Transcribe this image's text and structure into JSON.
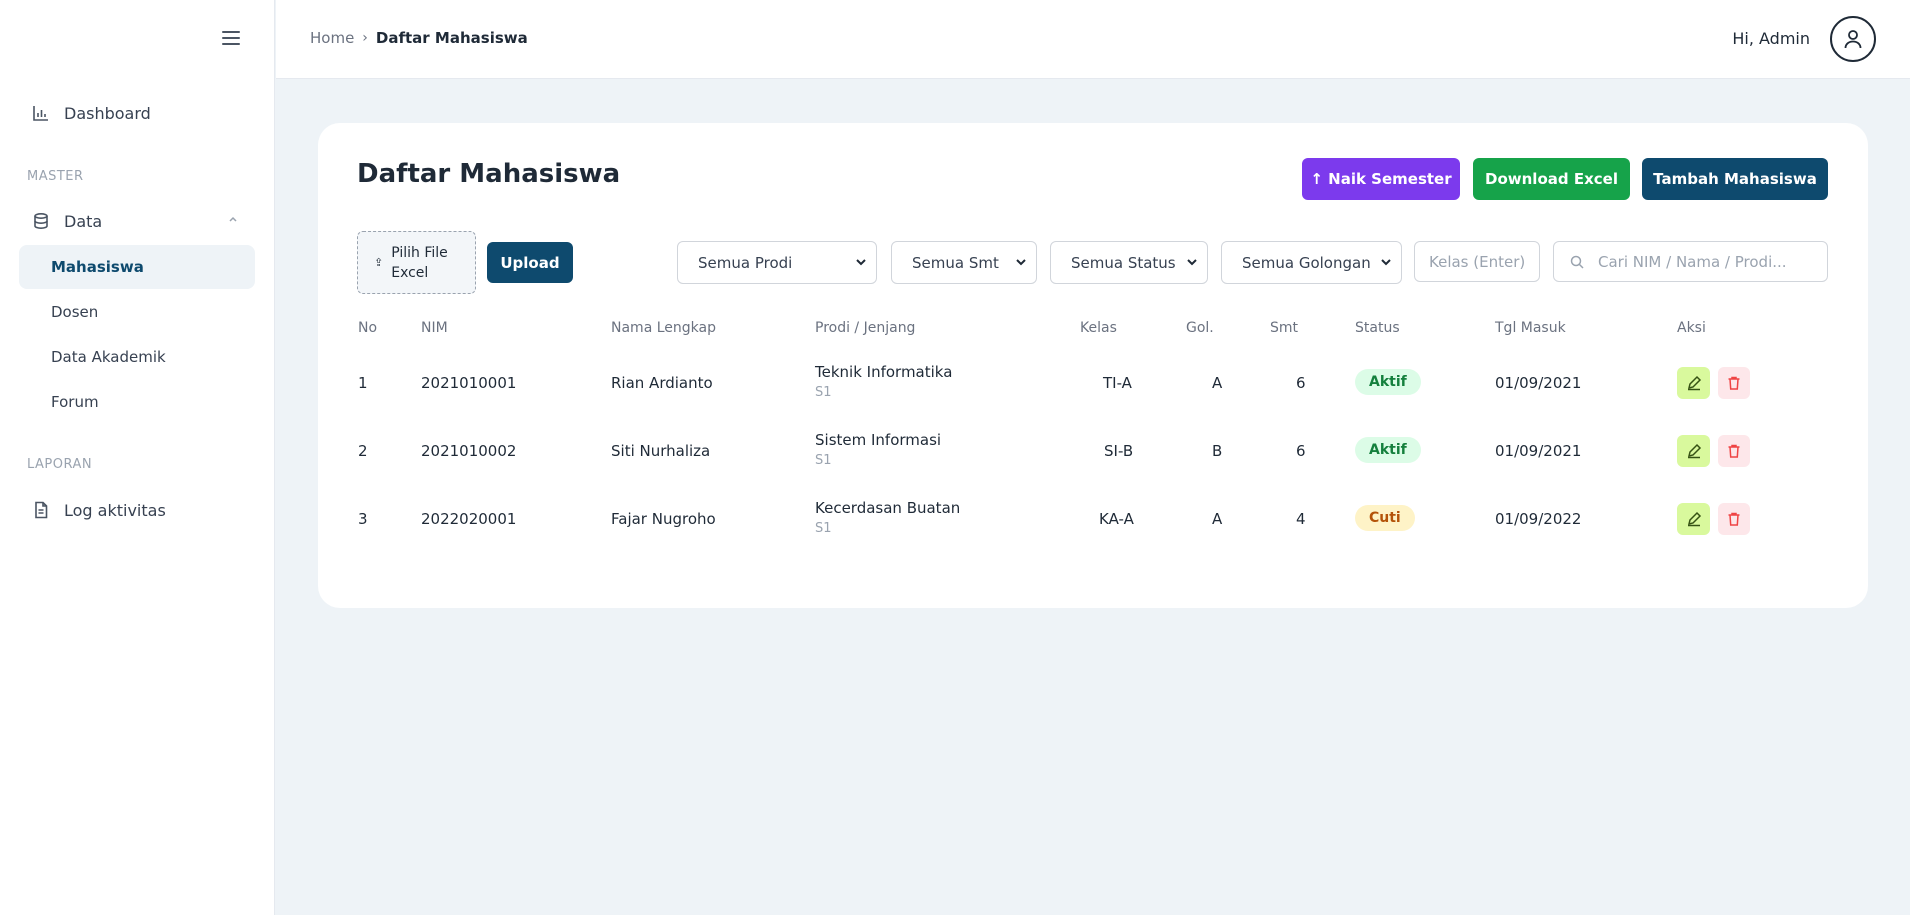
{
  "sidebar": {
    "items": [
      {
        "label": "Dashboard",
        "icon": "chart-icon"
      },
      {
        "label": "Data",
        "icon": "database-icon"
      },
      {
        "label": "Log aktivitas",
        "icon": "document-icon"
      }
    ],
    "sections": {
      "master": "MASTER",
      "laporan": "LAPORAN"
    },
    "subitems": [
      "Mahasiswa",
      "Dosen",
      "Data Akademik",
      "Forum"
    ],
    "active_subitem": "Mahasiswa"
  },
  "header": {
    "breadcrumb": {
      "home": "Home",
      "current": "Daftar Mahasiswa"
    },
    "greeting": "Hi, Admin"
  },
  "main": {
    "title": "Daftar Mahasiswa",
    "buttons": {
      "naik_semester": "↑ Naik Semester",
      "download_excel": "Download Excel",
      "tambah": "Tambah Mahasiswa",
      "upload": "Upload"
    },
    "file_pick": "Pilih File Excel",
    "filters": {
      "prodi": "Semua Prodi",
      "smt": "Semua Smt",
      "status": "Semua Status",
      "golongan": "Semua Golongan"
    },
    "kelas_placeholder": "Kelas (Enter)",
    "search_placeholder": "Cari NIM / Nama / Prodi...",
    "table": {
      "headers": [
        "No",
        "NIM",
        "Nama Lengkap",
        "Prodi / Jenjang",
        "Kelas",
        "Gol.",
        "Smt",
        "Status",
        "Tgl Masuk",
        "Aksi"
      ],
      "rows": [
        {
          "no": "1",
          "nim": "2021010001",
          "nama": "Rian Ardianto",
          "prodi": "Teknik Informatika",
          "jenjang": "S1",
          "kelas": "TI-A",
          "gol": "A",
          "smt": "6",
          "status": "Aktif",
          "tgl": "01/09/2021"
        },
        {
          "no": "2",
          "nim": "2021010002",
          "nama": "Siti Nurhaliza",
          "prodi": "Sistem Informasi",
          "jenjang": "S1",
          "kelas": "SI-B",
          "gol": "B",
          "smt": "6",
          "status": "Aktif",
          "tgl": "01/09/2021"
        },
        {
          "no": "3",
          "nim": "2022020001",
          "nama": "Fajar Nugroho",
          "prodi": "Kecerdasan Buatan",
          "jenjang": "S1",
          "kelas": "KA-A",
          "gol": "A",
          "smt": "4",
          "status": "Cuti",
          "tgl": "01/09/2022"
        }
      ]
    }
  },
  "colors": {
    "brand": "#0e4a6e",
    "naik": "#7c3aed",
    "download": "#16a34a",
    "aktif": "#15803d",
    "cuti": "#b45309"
  }
}
